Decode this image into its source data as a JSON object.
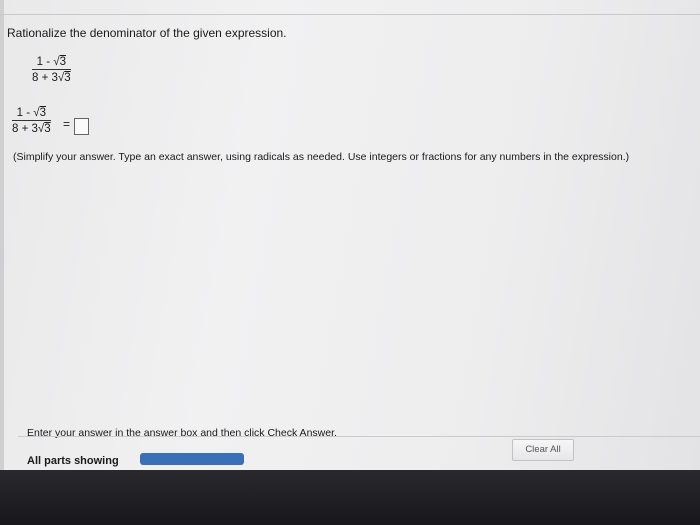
{
  "problem": {
    "instruction": "Rationalize the denominator of the given expression.",
    "expression": {
      "numerator_prefix": "1 - ",
      "numerator_radicand": "3",
      "denominator_prefix": "8 + 3",
      "denominator_radicand": "3"
    },
    "equals": "=",
    "answer_value": "",
    "hint": "(Simplify your answer. Type an exact answer, using radicals as needed. Use integers or fractions for any numbers in the expression.)"
  },
  "footer": {
    "message": "Enter your answer in the answer box and then click Check Answer.",
    "clear_all_label": "Clear All",
    "parts_label": "All parts showing",
    "progress": 1.0,
    "progress_color": "#3a70b8"
  }
}
